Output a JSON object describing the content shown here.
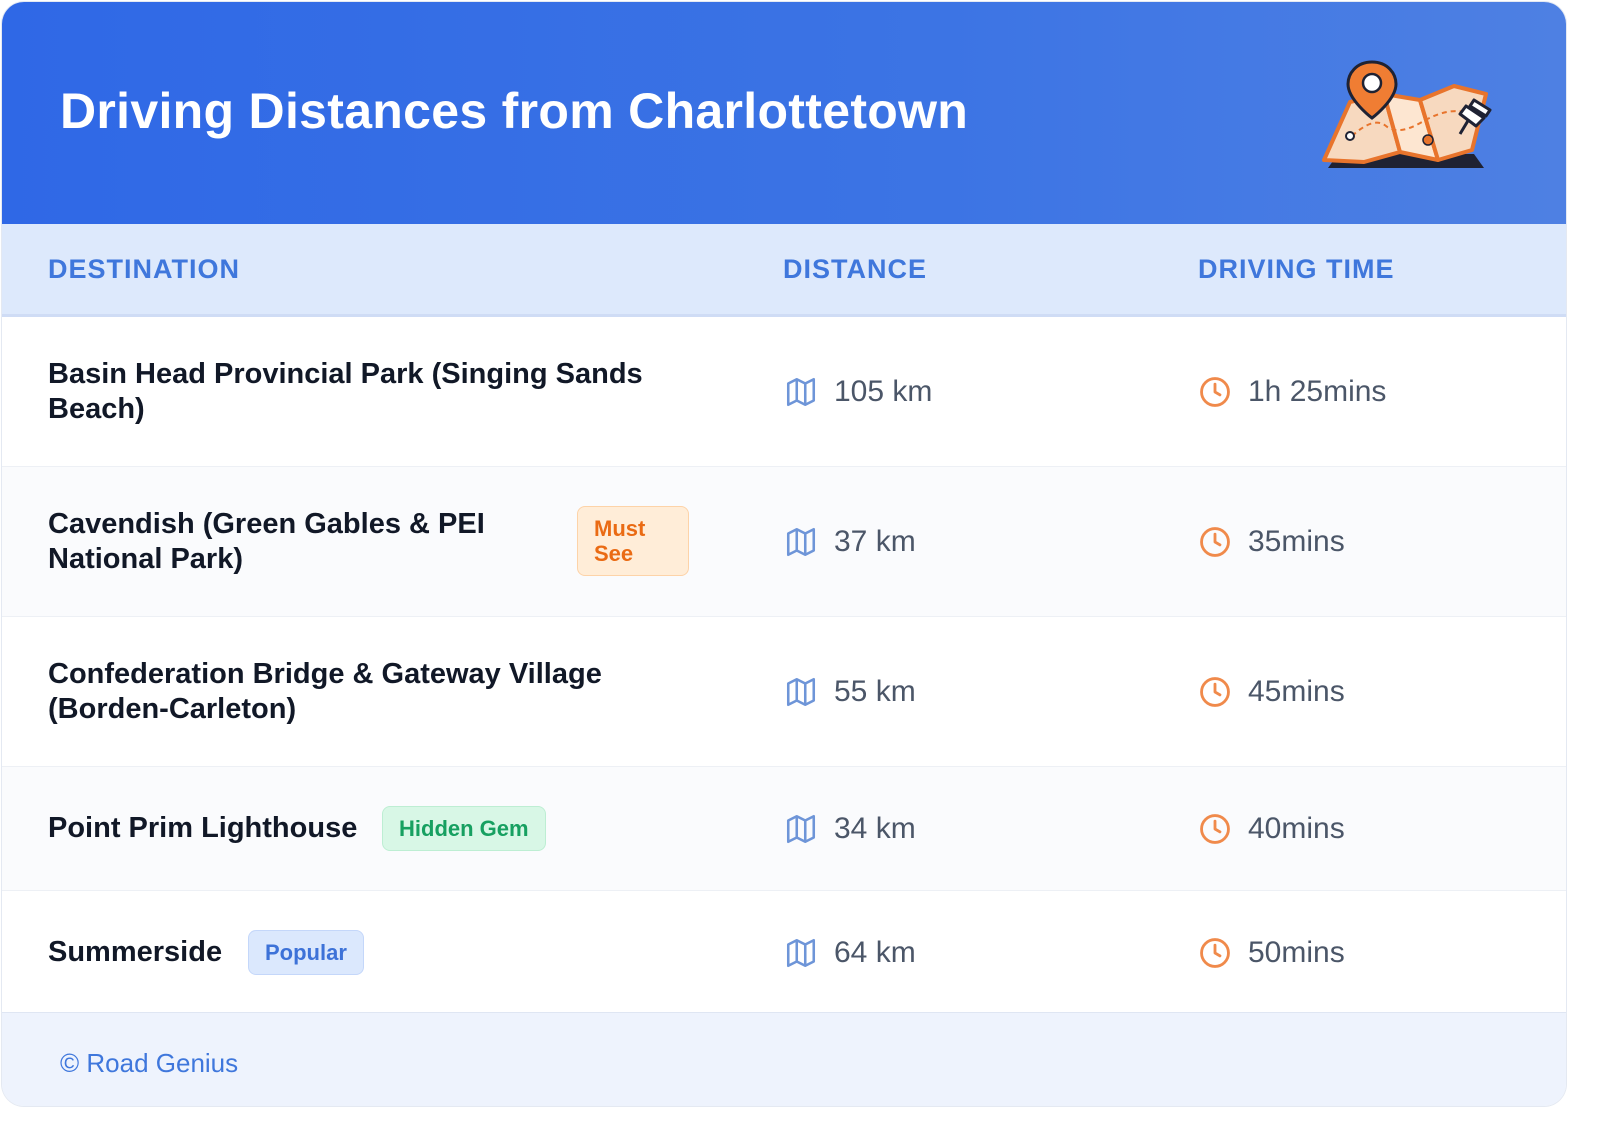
{
  "header": {
    "title": "Driving Distances from Charlottetown",
    "illustration_icon": "folded-map-with-pins-icon"
  },
  "table": {
    "columns": [
      "DESTINATION",
      "DISTANCE",
      "DRIVING TIME"
    ],
    "rows": [
      {
        "destination_line1": "Basin Head Provincial Park (Singing Sands",
        "destination_line2": "Beach)",
        "badge": "",
        "distance": "105 km",
        "driving_time": "1h 25mins"
      },
      {
        "destination_line1": "Cavendish (Green Gables & PEI",
        "destination_line2": "National Park)",
        "badge_line1": "Must",
        "badge_line2": "See",
        "badge_color": "orange",
        "distance": "37 km",
        "driving_time": "35mins"
      },
      {
        "destination_line1": "Confederation Bridge & Gateway Village",
        "destination_line2": "(Borden-Carleton)",
        "badge": "",
        "distance": "55 km",
        "driving_time": "45mins"
      },
      {
        "destination_line1": "Point Prim Lighthouse",
        "badge": "Hidden Gem",
        "badge_color": "green",
        "distance": "34 km",
        "driving_time": "40mins"
      },
      {
        "destination_line1": "Summerside",
        "badge": "Popular",
        "badge_color": "blue",
        "distance": "64 km",
        "driving_time": "50mins"
      }
    ]
  },
  "icons": {
    "distance": "map-icon",
    "time": "clock-icon"
  },
  "colors": {
    "header_gradient_start": "#2f68e6",
    "header_gradient_end": "#4e80e3",
    "column_header_text": "#3f77dc",
    "map_icon": "#6e95d8",
    "clock_icon": "#f08a4b",
    "badge_orange": "#ea6b14",
    "badge_green": "#17a061",
    "badge_blue": "#3d72d8"
  },
  "footer": {
    "text": "© Road Genius"
  }
}
